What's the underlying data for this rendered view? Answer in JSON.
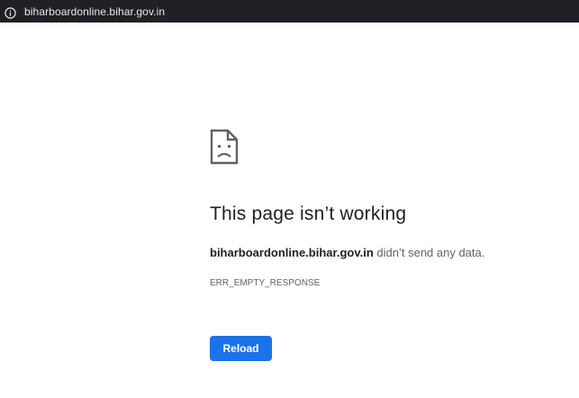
{
  "browser": {
    "url": "biharboardonline.bihar.gov.in",
    "info_icon": "info-icon"
  },
  "error_page": {
    "icon": "sad-page-icon",
    "title": "This page isn’t working",
    "host": "biharboardonline.bihar.gov.in",
    "message_suffix": " didn’t send any data.",
    "error_code": "ERR_EMPTY_RESPONSE",
    "reload_label": "Reload"
  },
  "colors": {
    "address_bar_bg": "#202124",
    "button_blue": "#1a73e8",
    "title_text": "#202124",
    "secondary_text": "#5f6368"
  }
}
